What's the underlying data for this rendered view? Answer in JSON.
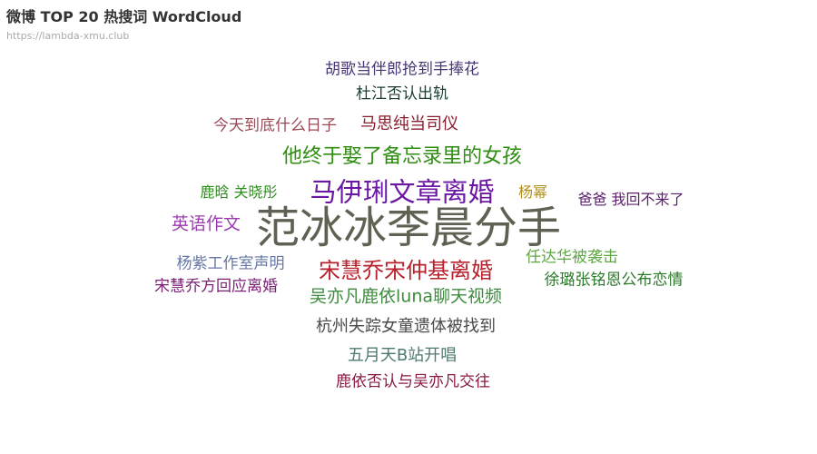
{
  "title": "微博 TOP 20 热搜词 WordCloud",
  "subtitle": "https://lambda-xmu.club",
  "chart_data": {
    "type": "wordcloud",
    "words": [
      {
        "text": "范冰冰李晨分手",
        "weight": 100,
        "color": "#5f6152"
      },
      {
        "text": "马伊琍文章离婚",
        "weight": 62,
        "color": "#6b17a4"
      },
      {
        "text": "宋慧乔宋仲基离婚",
        "weight": 52,
        "color": "#b8222d"
      },
      {
        "text": "他终于娶了备忘录里的女孩",
        "weight": 46,
        "color": "#2f8d12"
      },
      {
        "text": "胡歌当伴郎抢到手捧花",
        "weight": 36,
        "color": "#4a3775"
      },
      {
        "text": "杜江否认出轨",
        "weight": 36,
        "color": "#1d4033"
      },
      {
        "text": "马思纯当司仪",
        "weight": 38,
        "color": "#8c1d2c"
      },
      {
        "text": "今天到底什么日子",
        "weight": 36,
        "color": "#9a4a56"
      },
      {
        "text": "鹿晗 关晓彤",
        "weight": 34,
        "color": "#2c8e1c"
      },
      {
        "text": "杨幂",
        "weight": 34,
        "color": "#b08f1a"
      },
      {
        "text": "爸爸 我回不来了",
        "weight": 34,
        "color": "#5c1f6e"
      },
      {
        "text": "英语作文",
        "weight": 40,
        "color": "#9a3bb0"
      },
      {
        "text": "任达华被袭击",
        "weight": 36,
        "color": "#5ea742"
      },
      {
        "text": "杨紫工作室声明",
        "weight": 36,
        "color": "#6577a4"
      },
      {
        "text": "徐璐张铭恩公布恋情",
        "weight": 36,
        "color": "#2c7a2c"
      },
      {
        "text": "宋慧乔方回应离婚",
        "weight": 36,
        "color": "#7a1f74"
      },
      {
        "text": "吴亦凡鹿依luna聊天视频",
        "weight": 40,
        "color": "#3e8a3e"
      },
      {
        "text": "杭州失踪女童遗体被找到",
        "weight": 38,
        "color": "#4a4a4a"
      },
      {
        "text": "五月天B站开唱",
        "weight": 38,
        "color": "#4f7a72"
      },
      {
        "text": "鹿依否认与吴亦凡交往",
        "weight": 36,
        "color": "#881a45"
      }
    ]
  }
}
